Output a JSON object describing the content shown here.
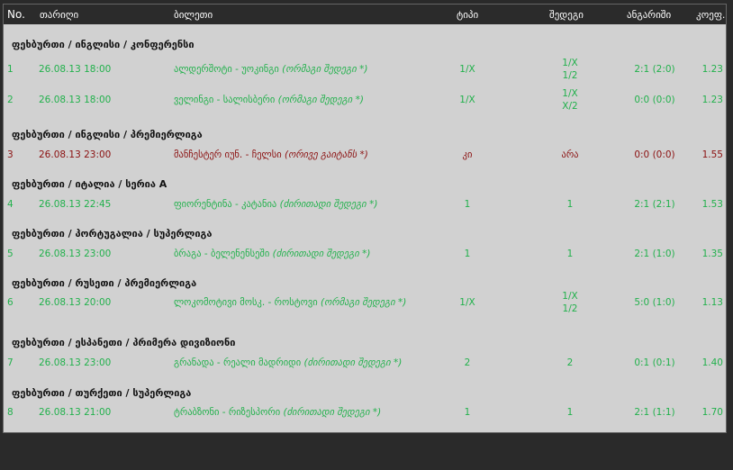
{
  "columns": {
    "no": "No.",
    "date": "თარიღი",
    "ticket": "ბილეთი",
    "type": "ტიპი",
    "result": "შედეგი",
    "calc": "ანგარიში",
    "coef": "კოეფ."
  },
  "groups": [
    {
      "title": "ფეხბურთი / ინგლისი / კონფერენსი",
      "rows": [
        {
          "no": "1",
          "date": "26.08.13 18:00",
          "event": "ალდერშოტი - უოკინგი",
          "note": "(ორმაგი შედეგი *)",
          "type": "1/X",
          "result": [
            "1/X",
            "1/2"
          ],
          "score": "2:1 (2:0)",
          "coef": "1.23",
          "status": "won"
        },
        {
          "no": "2",
          "date": "26.08.13 18:00",
          "event": "ველინგი - სალისბერი",
          "note": "(ორმაგი შედეგი *)",
          "type": "1/X",
          "result": [
            "1/X",
            "X/2"
          ],
          "score": "0:0 (0:0)",
          "coef": "1.23",
          "status": "won"
        }
      ]
    },
    {
      "title": "ფეხბურთი / ინგლისი / პრემიერლიგა",
      "rows": [
        {
          "no": "3",
          "date": "26.08.13 23:00",
          "event": "მანჩესტერ იუნ. - ჩელსი",
          "note": "(ორივე გაიტანს *)",
          "type": "კი",
          "result": [
            "არა"
          ],
          "score": "0:0 (0:0)",
          "coef": "1.55",
          "status": "lost"
        }
      ]
    },
    {
      "title": "ფეხბურთი / იტალია / სერია A",
      "rows": [
        {
          "no": "4",
          "date": "26.08.13 22:45",
          "event": "ფიორენტინა - კატანია",
          "note": "(ძირითადი შედეგი *)",
          "type": "1",
          "result": [
            "1"
          ],
          "score": "2:1 (2:1)",
          "coef": "1.53",
          "status": "won"
        }
      ]
    },
    {
      "title": "ფეხბურთი / პორტუგალია / სუპერლიგა",
      "rows": [
        {
          "no": "5",
          "date": "26.08.13 23:00",
          "event": "ბრაგა - ბელენენსეში",
          "note": "(ძირითადი შედეგი *)",
          "type": "1",
          "result": [
            "1"
          ],
          "score": "2:1 (1:0)",
          "coef": "1.35",
          "status": "won"
        }
      ]
    },
    {
      "title": "ფეხბურთი / რუსეთი / პრემიერლიგა",
      "rows": [
        {
          "no": "6",
          "date": "26.08.13 20:00",
          "event": "ლოკომოტივი მოსკ. - როსტოვი",
          "note": "(ორმაგი შედეგი *)",
          "type": "1/X",
          "result": [
            "1/X",
            "1/2"
          ],
          "score": "5:0 (1:0)",
          "coef": "1.13",
          "status": "won"
        }
      ]
    },
    {
      "title": "ფეხბურთი / ესპანეთი / პრიმერა დივიზიონი",
      "rows": [
        {
          "no": "7",
          "date": "26.08.13 23:00",
          "event": "გრანადა - რეალი მადრიდი",
          "note": "(ძირითადი შედეგი *)",
          "type": "2",
          "result": [
            "2"
          ],
          "score": "0:1 (0:1)",
          "coef": "1.40",
          "status": "won"
        }
      ]
    },
    {
      "title": "ფეხბურთი / თურქეთი / სუპერლიგა",
      "rows": [
        {
          "no": "8",
          "date": "26.08.13 21:00",
          "event": "ტრაბზონი - რიზესპორი",
          "note": "(ძირითადი შედეგი *)",
          "type": "1",
          "result": [
            "1"
          ],
          "score": "2:1 (1:1)",
          "coef": "1.70",
          "status": "won"
        }
      ]
    }
  ],
  "colors": {
    "won": "#22b14c",
    "lost": "#8b1010",
    "header_bg": "#2b2b2b",
    "panel_bg": "#d1d1d1",
    "page_bg": "#2a2a2a"
  }
}
